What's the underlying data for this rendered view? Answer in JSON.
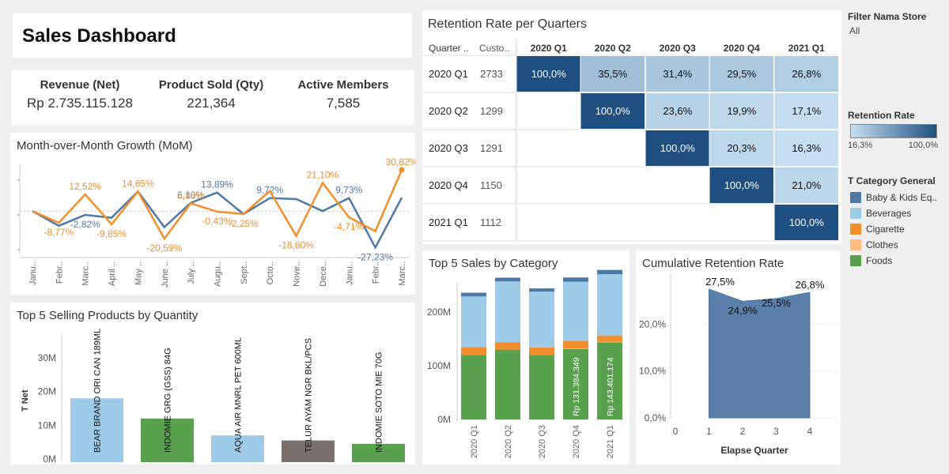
{
  "title": "Sales Dashboard",
  "kpis": [
    {
      "label": "Revenue (Net)",
      "value": "Rp 2.735.115.128"
    },
    {
      "label": "Product Sold (Qty)",
      "value": "221,364"
    },
    {
      "label": "Active Members",
      "value": "7,585"
    }
  ],
  "filter": {
    "label": "Filter Nama Store",
    "value": "All"
  },
  "retention_legend": {
    "title": "Retention Rate",
    "min": "16,3%",
    "max": "100,0%",
    "colors": {
      "low": "#c6dff0",
      "high": "#1f4f80"
    }
  },
  "category_legend": {
    "title": "T Category General",
    "items": [
      {
        "label": "Baby & Kids Eq..",
        "color": "#4e79a7"
      },
      {
        "label": "Beverages",
        "color": "#a0cbe8"
      },
      {
        "label": "Cigarette",
        "color": "#f28e2b"
      },
      {
        "label": "Clothes",
        "color": "#ffbe7d"
      },
      {
        "label": "Foods",
        "color": "#59a14f"
      }
    ]
  },
  "retention_table": {
    "title": "Retention Rate per Quarters",
    "row_header": "Quarter ..",
    "count_header": "Custo..",
    "columns": [
      "2020 Q1",
      "2020 Q2",
      "2020 Q3",
      "2020 Q4",
      "2021 Q1"
    ],
    "rows": [
      {
        "quarter": "2020 Q1",
        "customers": "2733",
        "cells": [
          "100,0%",
          "35,5%",
          "31,4%",
          "29,5%",
          "26,8%"
        ],
        "values": [
          100,
          35.5,
          31.4,
          29.5,
          26.8
        ]
      },
      {
        "quarter": "2020 Q2",
        "customers": "1299",
        "cells": [
          "",
          "100,0%",
          "23,6%",
          "19,9%",
          "17,1%"
        ],
        "values": [
          null,
          100,
          23.6,
          19.9,
          17.1
        ]
      },
      {
        "quarter": "2020 Q3",
        "customers": "1291",
        "cells": [
          "",
          "",
          "100,0%",
          "20,3%",
          "16,3%"
        ],
        "values": [
          null,
          null,
          100,
          20.3,
          16.3
        ]
      },
      {
        "quarter": "2020 Q4",
        "customers": "1150",
        "cells": [
          "",
          "",
          "",
          "100,0%",
          "21,0%"
        ],
        "values": [
          null,
          null,
          null,
          100,
          21.0
        ]
      },
      {
        "quarter": "2021 Q1",
        "customers": "1112",
        "cells": [
          "",
          "",
          "",
          "",
          "100,0%"
        ],
        "values": [
          null,
          null,
          null,
          null,
          100
        ]
      }
    ]
  },
  "chart_data": [
    {
      "id": "mom",
      "type": "line",
      "title": "Month-over-Month Growth (MoM)",
      "categories": [
        "Janu..",
        "Febr..",
        "Marc..",
        "April ..",
        "May ..",
        "June ..",
        "July ..",
        "Augu..",
        "Sept..",
        "Octo..",
        "Nove..",
        "Dece..",
        "Janu..",
        "Febr..",
        "Marc.."
      ],
      "series": [
        {
          "color": "#4e79a7",
          "values": [
            0,
            -11,
            -2.82,
            -5,
            14.65,
            -12,
            6.1,
            13.89,
            -2.25,
            9.72,
            9.0,
            0,
            9.73,
            -27.23,
            10
          ],
          "labels": [
            "",
            "",
            "-2,82%",
            "",
            "",
            "",
            "6,10%",
            "13,89%",
            "",
            "9,72%",
            "",
            "",
            "9,73%",
            "-27,23%",
            ""
          ]
        },
        {
          "color": "#f28e2b",
          "values": [
            0,
            -8.77,
            12.52,
            -9.85,
            14.65,
            -20.59,
            5.83,
            -0.43,
            -2.25,
            15,
            -18.6,
            21.1,
            -4.71,
            -15,
            30.82
          ],
          "labels": [
            "",
            "-8,77%",
            "12,52%",
            "-9,85%",
            "14,65%",
            "-20,59%",
            "5,83%",
            "-0,43%",
            "-2,25%",
            "",
            "-18,60%",
            "21,10%",
            "-4,71%",
            "",
            "30,82%"
          ]
        }
      ]
    },
    {
      "id": "top5products",
      "type": "bar",
      "title": "Top 5 Selling Products by Quantity",
      "ylabel": "T Net",
      "ylim": [
        0,
        30
      ],
      "yticks": [
        "0M",
        "10M",
        "20M",
        "30M"
      ],
      "categories": [
        "BEAR BRAND ORI CAN 189ML",
        "INDOMIE GRG (GSS) 84G",
        "AQUA AIR MNRL PET 600ML",
        "TELUR AYAM NGR BKL/PCS",
        "INDOMIE SOTO MIE 70G"
      ],
      "values": [
        18,
        12,
        7,
        5.5,
        4.5
      ],
      "colors": [
        "#a0cbe8",
        "#59a14f",
        "#a0cbe8",
        "#79706e",
        "#59a14f"
      ]
    },
    {
      "id": "top5sales",
      "type": "bar",
      "title": "Top 5 Sales by Category",
      "ylim": [
        0,
        250
      ],
      "yticks": [
        "0M",
        "100M",
        "200M"
      ],
      "categories": [
        "2020 Q1",
        "2020 Q2",
        "2020 Q3",
        "2020 Q4",
        "2021 Q1"
      ],
      "series": [
        {
          "name": "Foods",
          "color": "#59a14f",
          "values": [
            120,
            130,
            120,
            131.4,
            143.4
          ],
          "labels": [
            "",
            "",
            "",
            "Rp 131.384.349",
            "Rp 143.401.174"
          ]
        },
        {
          "name": "Clothes",
          "color": "#ffbe7d",
          "values": [
            0,
            0,
            0,
            1,
            1
          ]
        },
        {
          "name": "Cigarette",
          "color": "#f28e2b",
          "values": [
            15,
            14,
            14,
            14,
            12
          ]
        },
        {
          "name": "Beverages",
          "color": "#a0cbe8",
          "values": [
            94,
            113,
            104,
            110,
            114
          ]
        },
        {
          "name": "Baby & Kids Eq..",
          "color": "#4e79a7",
          "values": [
            7,
            7,
            6,
            8,
            8
          ]
        }
      ]
    },
    {
      "id": "cumret",
      "type": "area",
      "title": "Cumulative Retention Rate",
      "xlabel": "Elapse Quarter",
      "xticks": [
        "0",
        "1",
        "2",
        "3",
        "4",
        "5"
      ],
      "yticks": [
        "0,0%",
        "10,0%",
        "20,0%"
      ],
      "ylim": [
        0,
        28
      ],
      "color": "#5b7fa8",
      "x": [
        1,
        2,
        3,
        4
      ],
      "values": [
        27.5,
        24.9,
        25.5,
        26.8
      ],
      "labels": [
        "27,5%",
        "24,9%",
        "25,5%",
        "26,8%"
      ]
    }
  ]
}
